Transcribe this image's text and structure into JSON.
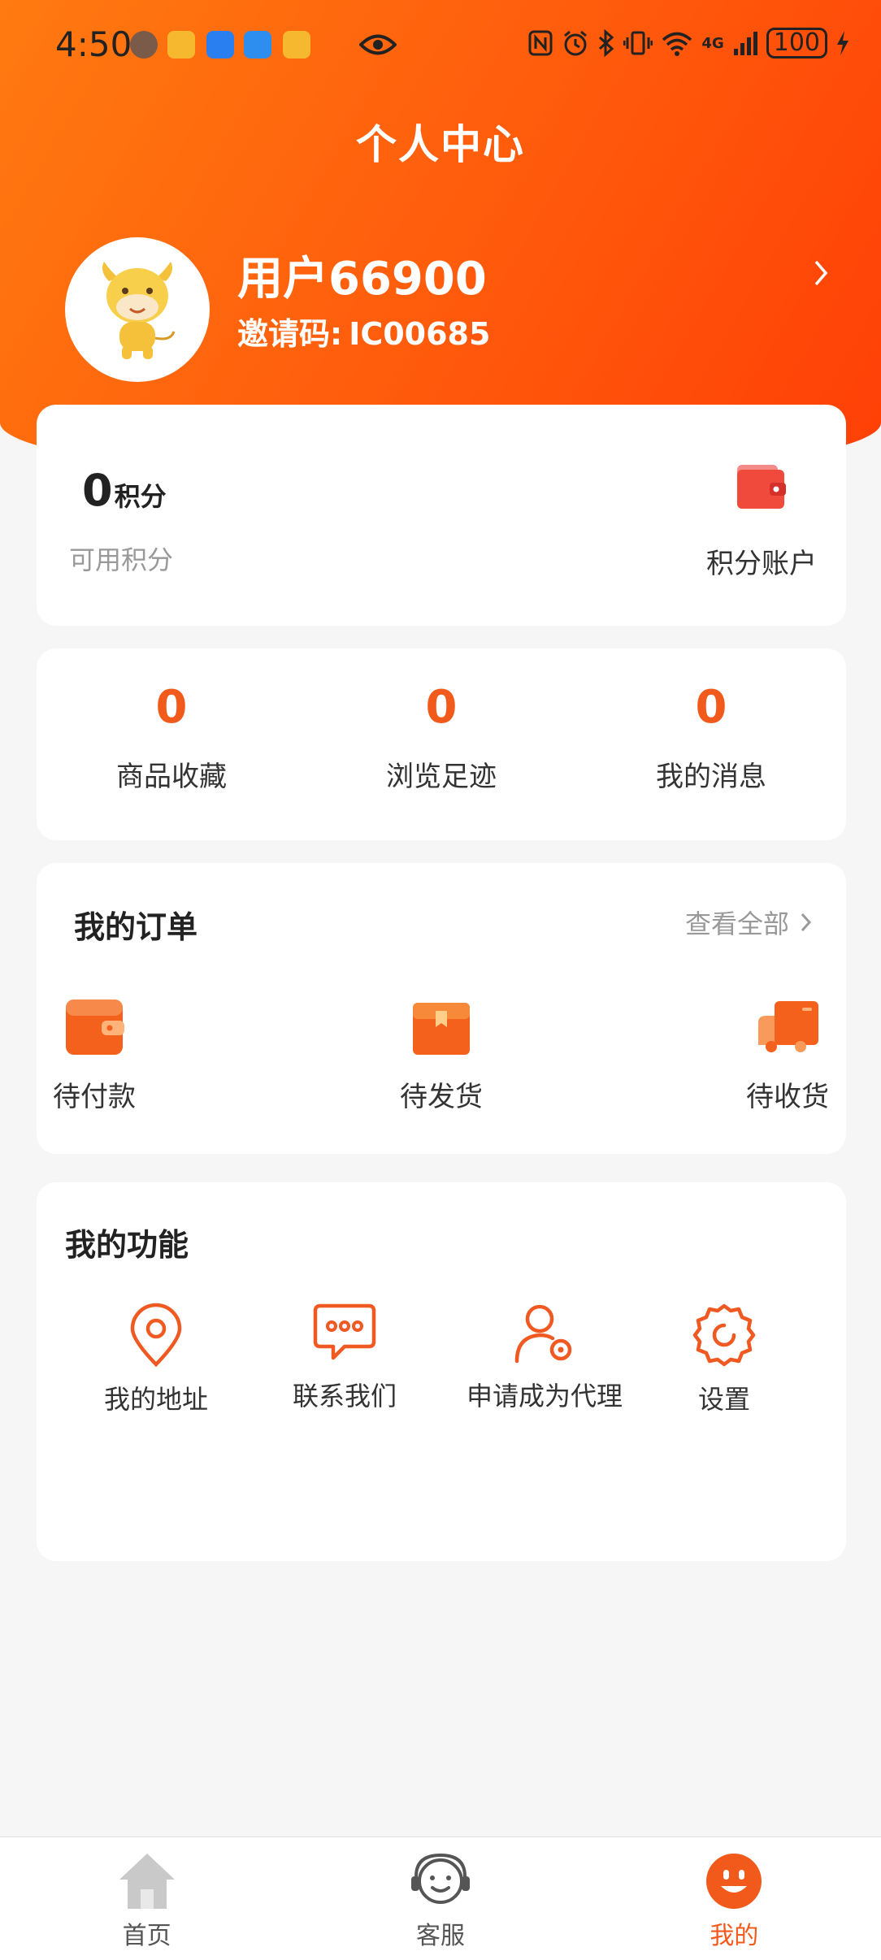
{
  "status_bar": {
    "time": "4:50",
    "network": "4G",
    "battery": "100"
  },
  "header": {
    "title": "个人中心"
  },
  "profile": {
    "username": "用户66900",
    "invite_label": "邀请码:",
    "invite_code": "IC00685"
  },
  "points": {
    "value": "0",
    "unit": "积分",
    "label": "可用积分",
    "account_label": "积分账户"
  },
  "stats": [
    {
      "value": "0",
      "label": "商品收藏"
    },
    {
      "value": "0",
      "label": "浏览足迹"
    },
    {
      "value": "0",
      "label": "我的消息"
    }
  ],
  "orders": {
    "title": "我的订单",
    "view_all": "查看全部",
    "items": [
      {
        "label": "待付款",
        "icon": "wallet-icon"
      },
      {
        "label": "待发货",
        "icon": "package-icon"
      },
      {
        "label": "待收货",
        "icon": "truck-icon"
      }
    ]
  },
  "functions": {
    "title": "我的功能",
    "items": [
      {
        "label": "我的地址",
        "icon": "location-pin-icon"
      },
      {
        "label": "联系我们",
        "icon": "chat-bubble-icon"
      },
      {
        "label": "申请成为代理",
        "icon": "user-gear-icon"
      },
      {
        "label": "设置",
        "icon": "settings-icon"
      }
    ]
  },
  "tabbar": [
    {
      "label": "首页",
      "icon": "home-icon",
      "active": false
    },
    {
      "label": "客服",
      "icon": "customer-service-icon",
      "active": false
    },
    {
      "label": "我的",
      "icon": "profile-smile-icon",
      "active": true
    }
  ],
  "colors": {
    "accent": "#f25a1c",
    "header_gradient_start": "#ff7a10",
    "header_gradient_end": "#ff3f06"
  }
}
